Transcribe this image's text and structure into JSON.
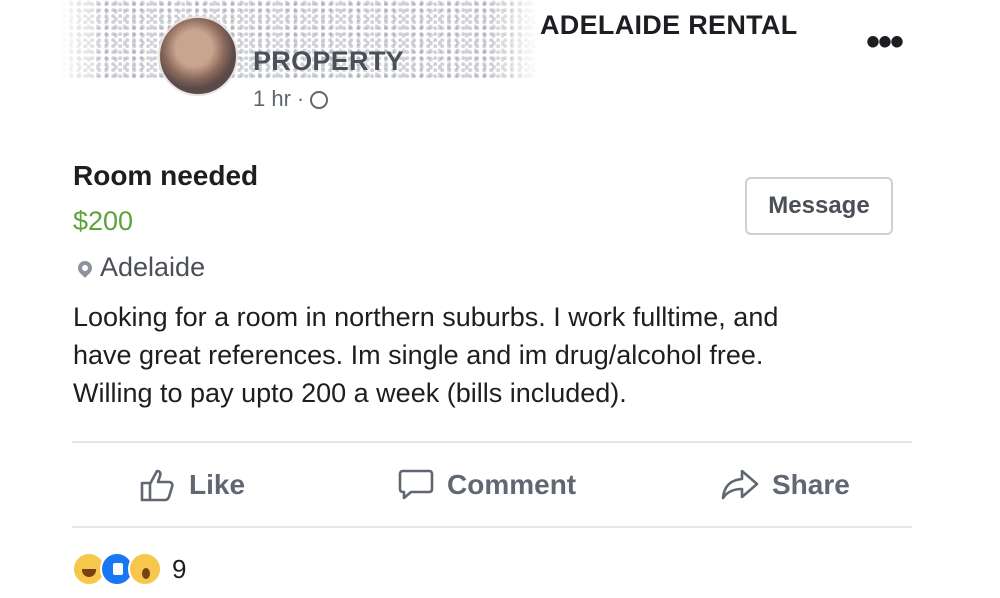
{
  "header": {
    "group_name": "ADELAIDE RENTAL",
    "group_name_line2": "PROPERTY",
    "time": "1 hr",
    "separator": "·",
    "privacy_icon": "globe-icon",
    "more_label": "•••"
  },
  "listing": {
    "title": "Room needed",
    "price": "$200",
    "location": "Adelaide",
    "location_icon": "pin-icon",
    "message_button": "Message",
    "description": [
      "Looking for a room in northern suburbs. I work fulltime, and",
      "have great references. Im single and im drug/alcohol free.",
      "Willing to pay upto 200 a week (bills included)."
    ]
  },
  "actions": [
    {
      "label": "Like",
      "icon": "thumbs-up-icon"
    },
    {
      "label": "Comment",
      "icon": "comment-icon"
    },
    {
      "label": "Share",
      "icon": "share-icon"
    }
  ],
  "reactions": {
    "icons": [
      "haha-icon",
      "like-icon",
      "wow-icon"
    ],
    "count": "9"
  },
  "colors": {
    "price": "#5fa23b",
    "secondary_text": "#606770",
    "divider": "#e4e6eb"
  }
}
